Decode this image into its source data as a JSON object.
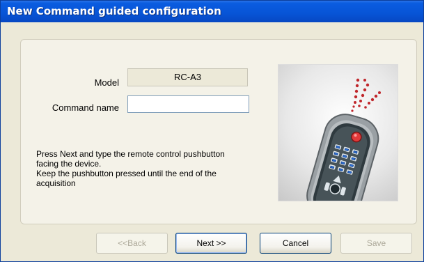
{
  "window": {
    "title": "New Command guided configuration"
  },
  "form": {
    "model_label": "Model",
    "model_value": "RC-A3",
    "command_label": "Command name",
    "command_value": ""
  },
  "instructions": {
    "line1": "Press Next and type the remote control pushbutton",
    "line2": "facing the device.",
    "line3": "Keep the pushbutton pressed until the end of the",
    "line4": "acquisition"
  },
  "illustration": {
    "icon": "remote-control-illustration"
  },
  "buttons": {
    "back": "<<Back",
    "next": "Next >>",
    "cancel": "Cancel",
    "save": "Save"
  }
}
